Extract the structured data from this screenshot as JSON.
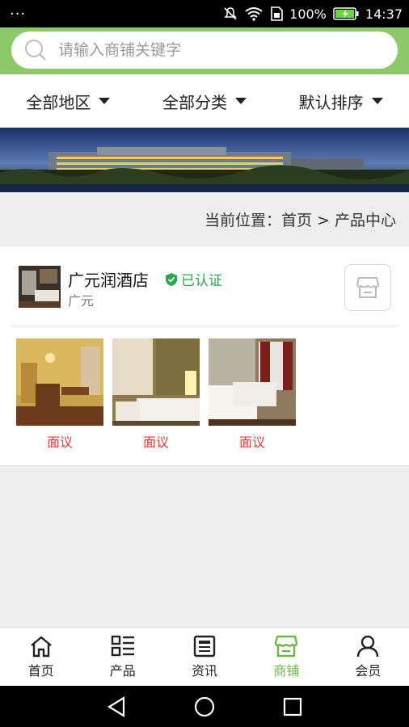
{
  "status_bar": {
    "dots": "···",
    "battery": "100%",
    "time": "14:37"
  },
  "search": {
    "placeholder": "请输入商铺关键字",
    "value": ""
  },
  "filters": [
    {
      "label": "全部地区"
    },
    {
      "label": "全部分类"
    },
    {
      "label": "默认排序"
    }
  ],
  "breadcrumb": "当前位置：首页 > 产品中心",
  "shop": {
    "name": "广元润酒店",
    "verified_label": "已认证",
    "city": "广元",
    "products": [
      {
        "price": "面议"
      },
      {
        "price": "面议"
      },
      {
        "price": "面议"
      }
    ]
  },
  "tabs": [
    {
      "label": "首页",
      "icon": "home-icon"
    },
    {
      "label": "产品",
      "icon": "list-icon"
    },
    {
      "label": "资讯",
      "icon": "news-icon"
    },
    {
      "label": "商铺",
      "icon": "store-icon",
      "active": true
    },
    {
      "label": "会员",
      "icon": "user-icon"
    }
  ],
  "colors": {
    "brand_green": "#8bc96a",
    "active_tab": "#6cb849",
    "price_red": "#e03c3c",
    "verified_green": "#29a84a"
  }
}
